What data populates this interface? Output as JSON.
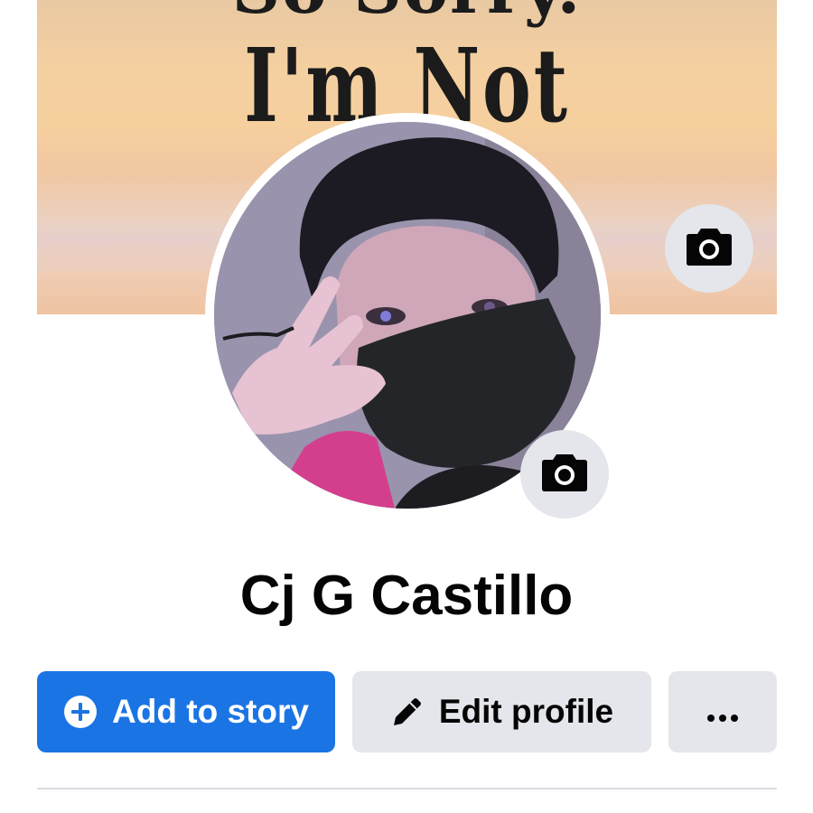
{
  "cover": {
    "text_line_1": "So Sorry.",
    "text_line_2": "I'm Not",
    "camera_icon": "camera-icon"
  },
  "profile": {
    "name": "Cj G Castillo",
    "camera_icon": "camera-icon"
  },
  "actions": {
    "add_story_label": "Add to story",
    "add_story_icon": "plus-circle-icon",
    "edit_profile_label": "Edit profile",
    "edit_profile_icon": "pencil-icon",
    "more_icon": "more-horizontal-icon"
  },
  "colors": {
    "primary_blue": "#1b74e4",
    "secondary_gray": "#e4e6eb",
    "text": "#050505"
  }
}
